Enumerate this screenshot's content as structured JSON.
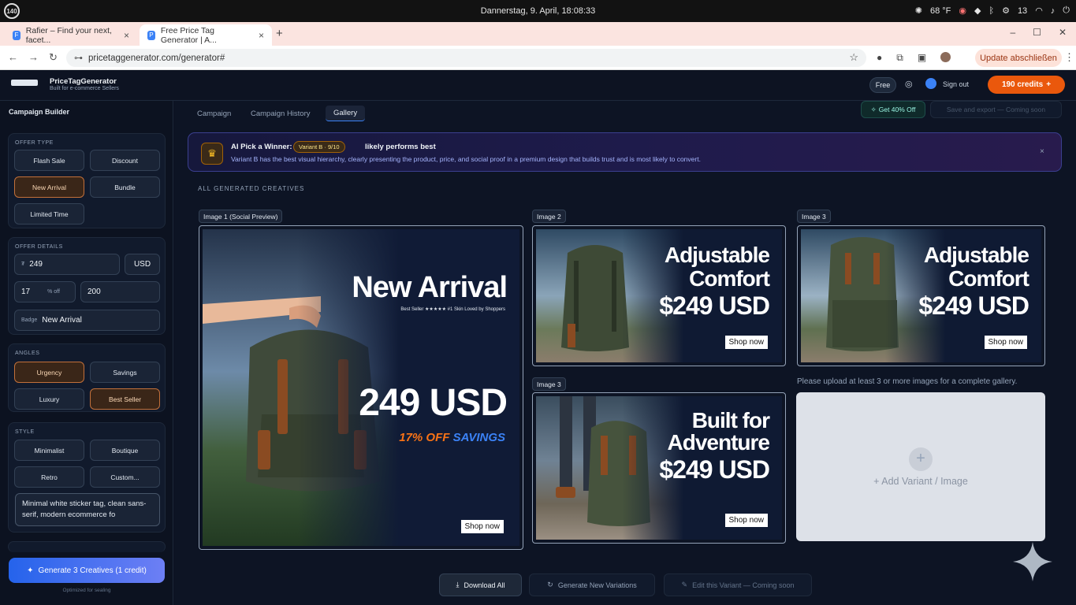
{
  "os": {
    "logo": "140",
    "clock": "Dannerstag, 9. April, 18:08:33",
    "weather": "68 °F",
    "battery": "13"
  },
  "browser": {
    "tabs": [
      {
        "title": "Rafier – Find your next, facet...",
        "active": false
      },
      {
        "title": "Free Price Tag Generator | A...",
        "active": true
      }
    ],
    "url": "pricetaggenerator.com/generator#",
    "update_label": "Update abschließen"
  },
  "app": {
    "brand_name": "PriceTagGenerator",
    "brand_sub": "Built for e-commerce Sellers",
    "plan_badge": "Free",
    "signout": "Sign out",
    "credits": "190 credits",
    "credits_plus": "+"
  },
  "sidebar": {
    "title": "Campaign Builder",
    "offer_type": {
      "heading": "Offer Type",
      "options": [
        "Flash Sale",
        "Discount",
        "New Arrival",
        "Bundle",
        "Limited Time"
      ],
      "selected": "New Arrival"
    },
    "offer_details": {
      "heading": "Offer Details",
      "price": "249",
      "currency": "USD",
      "discount": "17",
      "discount_unit": "% off",
      "original": "200",
      "badge_prefix": "Badge",
      "badge": "New Arrival"
    },
    "angles": {
      "heading": "Angles",
      "options": [
        "Urgency",
        "Savings",
        "Luxury",
        "Best Seller"
      ],
      "selected": [
        "Urgency",
        "Best Seller"
      ]
    },
    "style": {
      "heading": "Style",
      "options": [
        "Minimalist",
        "Boutique",
        "Retro",
        "Custom..."
      ],
      "prompt": "Minimal white sticker tag, clean sans-serif, modern ecommerce fo"
    },
    "generate_label": "Generate 3 Creatives (1 credit)",
    "generate_note": "Optimized for sealing"
  },
  "main": {
    "tabs": [
      "Campaign",
      "Campaign History",
      "Gallery"
    ],
    "active_tab": "Gallery",
    "offer_badge": "Get 40% Off",
    "save_export": "Save and export — Coming soon",
    "banner": {
      "title": "AI Pick a Winner:",
      "pill": "Variant B · 9/10",
      "title2": "likely performs best",
      "desc": "Variant B has the best visual hierarchy, clearly presenting the product, price, and social proof in a premium design that builds trust and is most likely to convert.",
      "close": "×"
    },
    "gallery_heading": "ALL GENERATED CREATIVES",
    "creatives": [
      {
        "label": "Image 1 (Social Preview)",
        "headline": "New Arrival",
        "tagline": "Best Seller ★★★★★ #1 Skin Loved by Shoppers",
        "price": "249 USD",
        "discount": "17% OFF",
        "savings": "SAVINGS",
        "cta": "Shop now"
      },
      {
        "label": "Image 2",
        "line1": "Adjustable",
        "line2": "Comfort",
        "price": "$249 USD",
        "cta": "Shop now"
      },
      {
        "label": "Image 3",
        "line1": "Adjustable",
        "line2": "Comfort",
        "price": "$249 USD",
        "cta": "Shop now"
      },
      {
        "label": "Image 3",
        "line1": "Built for",
        "line2": "Adventure",
        "price": "$249 USD",
        "cta": "Shop now"
      }
    ],
    "upload_note": "Please upload at least 3 or more images for a complete gallery.",
    "add_variant": "+ Add Variant / Image",
    "actions": {
      "download_all": "Download All",
      "generate_new": "Generate New Variations",
      "edit_variant": "Edit this Variant — Coming soon"
    }
  },
  "colors": {
    "accent_orange": "#ea580c",
    "primary_blue": "#2563eb",
    "selected_chip": "#c2703a"
  }
}
